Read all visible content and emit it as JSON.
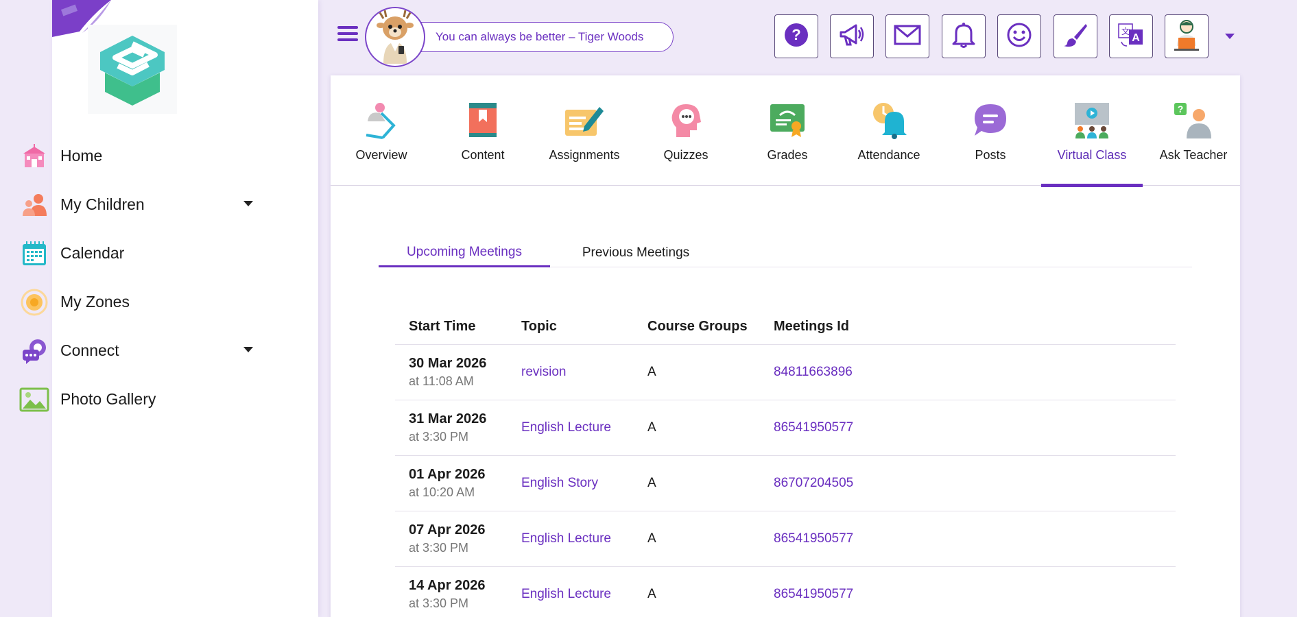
{
  "colors": {
    "accent": "#6a2fc0",
    "background": "#efe9f8"
  },
  "sidebar": {
    "items": [
      {
        "label": "Home",
        "icon": "school-icon",
        "has_submenu": false
      },
      {
        "label": "My Children",
        "icon": "children-icon",
        "has_submenu": true
      },
      {
        "label": "Calendar",
        "icon": "calendar-icon",
        "has_submenu": false
      },
      {
        "label": "My Zones",
        "icon": "zones-icon",
        "has_submenu": false
      },
      {
        "label": "Connect",
        "icon": "connect-icon",
        "has_submenu": true
      },
      {
        "label": "Photo Gallery",
        "icon": "photo-gallery-icon",
        "has_submenu": false
      }
    ]
  },
  "header": {
    "quote": "You can always be better – Tiger Woods",
    "buttons": [
      "help-icon",
      "megaphone-icon",
      "mail-icon",
      "bell-icon",
      "smiley-icon",
      "paintbrush-icon",
      "translate-icon",
      "profile-avatar-icon"
    ]
  },
  "tabs": [
    {
      "label": "Overview",
      "icon": "overview-icon",
      "active": false
    },
    {
      "label": "Content",
      "icon": "book-icon",
      "active": false
    },
    {
      "label": "Assignments",
      "icon": "assignment-icon",
      "active": false
    },
    {
      "label": "Quizzes",
      "icon": "quiz-icon",
      "active": false
    },
    {
      "label": "Grades",
      "icon": "certificate-icon",
      "active": false
    },
    {
      "label": "Attendance",
      "icon": "attendance-bell-icon",
      "active": false
    },
    {
      "label": "Posts",
      "icon": "chat-bubble-icon",
      "active": false
    },
    {
      "label": "Virtual Class",
      "icon": "virtual-class-icon",
      "active": true
    },
    {
      "label": "Ask Teacher",
      "icon": "ask-teacher-icon",
      "active": false
    }
  ],
  "subtabs": {
    "upcoming": "Upcoming Meetings",
    "previous": "Previous Meetings"
  },
  "table": {
    "headers": {
      "start_time": "Start Time",
      "topic": "Topic",
      "course_groups": "Course Groups",
      "meetings_id": "Meetings Id"
    },
    "rows": [
      {
        "date": "30 Mar 2026",
        "time": "at 11:08 AM",
        "topic": "revision",
        "group": "A",
        "meeting_id": "84811663896"
      },
      {
        "date": "31 Mar 2026",
        "time": "at 3:30 PM",
        "topic": "English Lecture",
        "group": "A",
        "meeting_id": "86541950577"
      },
      {
        "date": "01 Apr 2026",
        "time": "at 10:20 AM",
        "topic": "English Story",
        "group": "A",
        "meeting_id": "86707204505"
      },
      {
        "date": "07 Apr 2026",
        "time": "at 3:30 PM",
        "topic": "English Lecture",
        "group": "A",
        "meeting_id": "86541950577"
      },
      {
        "date": "14 Apr 2026",
        "time": "at 3:30 PM",
        "topic": "English Lecture",
        "group": "A",
        "meeting_id": "86541950577"
      }
    ]
  }
}
